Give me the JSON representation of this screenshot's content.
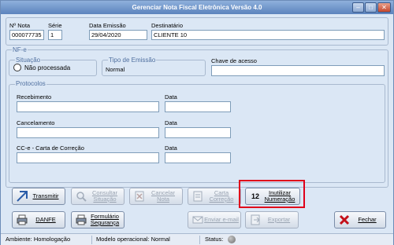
{
  "window": {
    "title": "Gerenciar Nota Fiscal Eletrônica Versão 4.0"
  },
  "header": {
    "numero_label": "Nº Nota",
    "numero_value": "000077735",
    "serie_label": "Série",
    "serie_value": "1",
    "data_label": "Data Emissão",
    "data_value": "29/04/2020",
    "dest_label": "Destinatário",
    "dest_value": "CLIENTE 10"
  },
  "nfe": {
    "group_label": "NF-e",
    "situacao_label": "Situação",
    "situacao_value": "Não processada",
    "tipo_label": "Tipo de Emissão",
    "tipo_value": "Normal",
    "chave_label": "Chave de acesso",
    "chave_value": ""
  },
  "protocolos": {
    "group_label": "Protocolos",
    "recebimento_label": "Recebimento",
    "cancelamento_label": "Cancelamento",
    "cce_label": "CC-e - Carta de Correção",
    "data_label": "Data"
  },
  "buttons": {
    "transmitir": "Transmitir",
    "consultar": "Consultar Situação",
    "cancelar": "Cancelar Nota",
    "carta": "Carta Correção",
    "inutilizar": "Inutilizar Numeração",
    "inutilizar_icon_text": "12",
    "danfe": "DANFE",
    "formulario": "Formulário Segurança",
    "enviar": "Enviar e-mail",
    "exportar": "Exportar",
    "fechar": "Fechar"
  },
  "statusbar": {
    "ambiente": "Ambiente: Homologação",
    "modelo": "Modelo operacional: Normal",
    "status": "Status:"
  },
  "colors": {
    "highlight": "#e0001a",
    "titlebar": "#5b83bd",
    "close": "#c4452b"
  }
}
